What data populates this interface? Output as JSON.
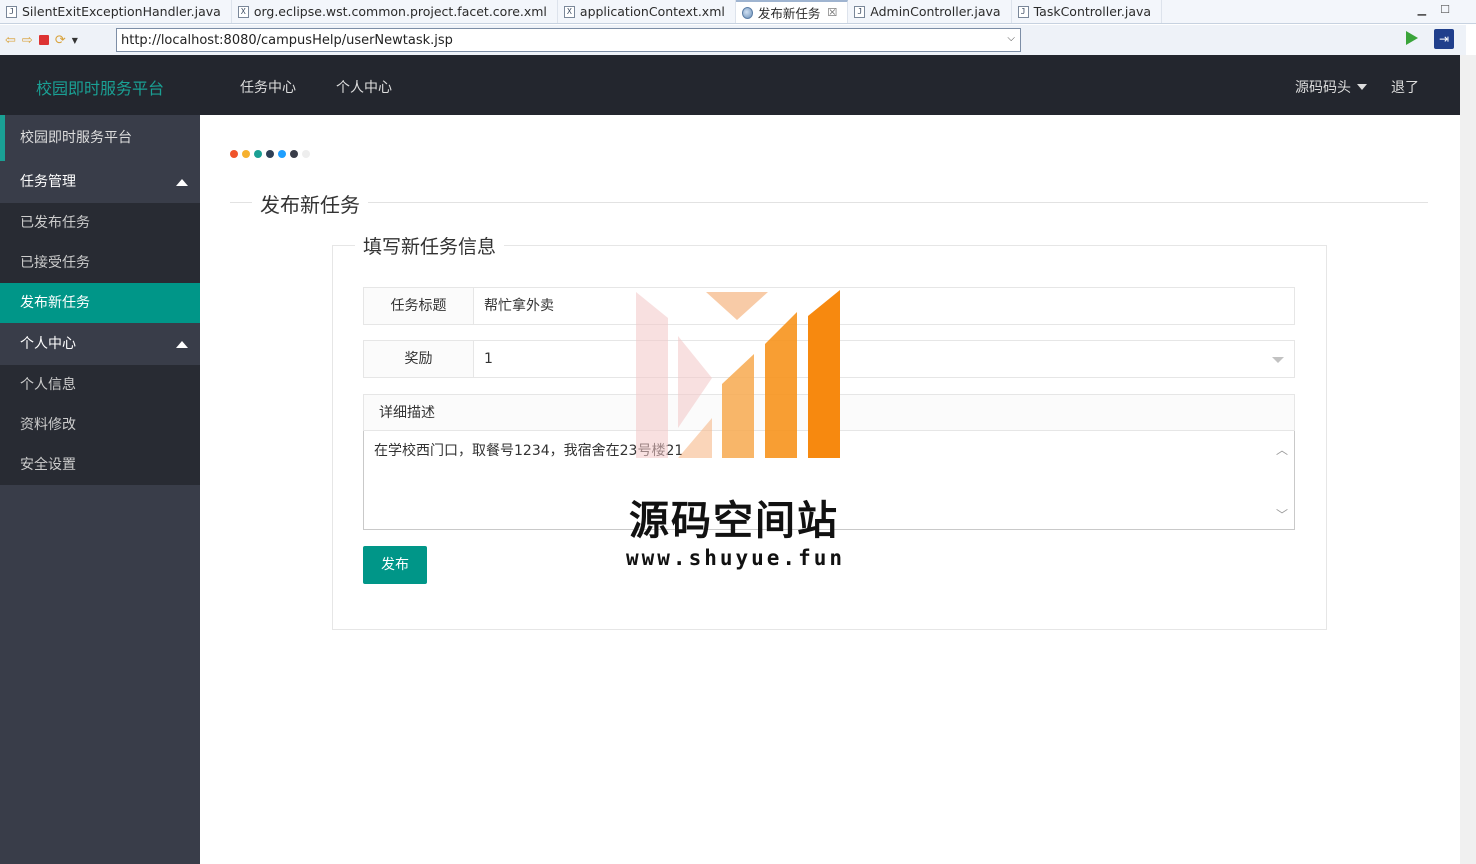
{
  "tabs": [
    {
      "label": "SilentExitExceptionHandler.java",
      "icon": "J"
    },
    {
      "label": "org.eclipse.wst.common.project.facet.core.xml",
      "icon": "X"
    },
    {
      "label": "applicationContext.xml",
      "icon": "X"
    },
    {
      "label": "发布新任务",
      "icon": "globe",
      "active": true,
      "close": "☒"
    },
    {
      "label": "AdminController.java",
      "icon": "J"
    },
    {
      "label": "TaskController.java",
      "icon": "J"
    }
  ],
  "browser": {
    "url": "http://localhost:8080/campusHelp/userNewtask.jsp"
  },
  "topnav": {
    "brand": "校园即时服务平台",
    "items": [
      "任务中心",
      "个人中心"
    ],
    "user": "源码码头",
    "logout": "退了"
  },
  "sidebar": {
    "head": "校园即时服务平台",
    "groups": [
      {
        "label": "任务管理",
        "items": [
          "已发布任务",
          "已接受任务",
          "发布新任务"
        ],
        "active": "发布新任务"
      },
      {
        "label": "个人中心",
        "items": [
          "个人信息",
          "资料修改",
          "安全设置"
        ]
      }
    ]
  },
  "main": {
    "dot_colors": [
      "#f0542b",
      "#f6b12f",
      "#1aa094",
      "#2f4056",
      "#1e9fff",
      "#393d49",
      "#eeeeee"
    ],
    "section_title": "发布新任务",
    "form": {
      "legend": "填写新任务信息",
      "title_label": "任务标题",
      "title_value": "帮忙拿外卖",
      "reward_label": "奖励",
      "reward_value": "1",
      "desc_label": "详细描述",
      "desc_value": "在学校西门口，取餐号1234，我宿舍在23号楼21",
      "submit_label": "发布"
    }
  },
  "watermark": {
    "name": "源码空间站",
    "url": "www.shuyue.fun"
  }
}
